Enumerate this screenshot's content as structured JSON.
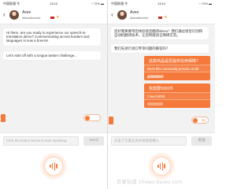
{
  "left_screen": {
    "status": {
      "carrier": "中国联通 令",
      "time": "13:10",
      "battery": "◔ 72% ▬"
    },
    "agent": {
      "name": "Avee",
      "role": "Manufacturer"
    },
    "messages": [
      "Hi there, are you ready to experience our speech-to-translation demo? Communicating across borders and languages is now a breeze!",
      "Let's start off with a tongue twister challenge..."
    ],
    "input": {
      "placeholder": "Click the button below to start speaking",
      "send_label": "Send"
    }
  },
  "right_screen": {
    "status": {
      "carrier": "中国联通 令",
      "time": "13:10",
      "battery": "◔ 72% ▬"
    },
    "agent": {
      "name": "Avee",
      "role": "Manufacturer"
    },
    "messages": [
      "您好我将要带您体验语音翻译demo！我们通过语音识别和自动机翻译技术，让您跨越语言障碍交流。",
      "我们先进行进口专项问题的解答吗？"
    ],
    "cards": [
      {
        "question_cn": "这款商品是否提供信用保障?",
        "question_en": "Does this commodity provide credit guarantee?"
      },
      {
        "question_cn": "我需要5000件",
        "question_en": "I need 5000."
      }
    ],
    "toggle_label": "EN",
    "input": {
      "placeholder": "点击下方麦克风开始语音输入",
      "send_label": "发送"
    }
  },
  "watermark": "百度知道 zhidao.baidu.com",
  "colors": {
    "accent": "#f5793a",
    "background": "#f2f2f2"
  },
  "icons": [
    "back-icon",
    "star-icon",
    "flag-icon",
    "mic-icon"
  ]
}
